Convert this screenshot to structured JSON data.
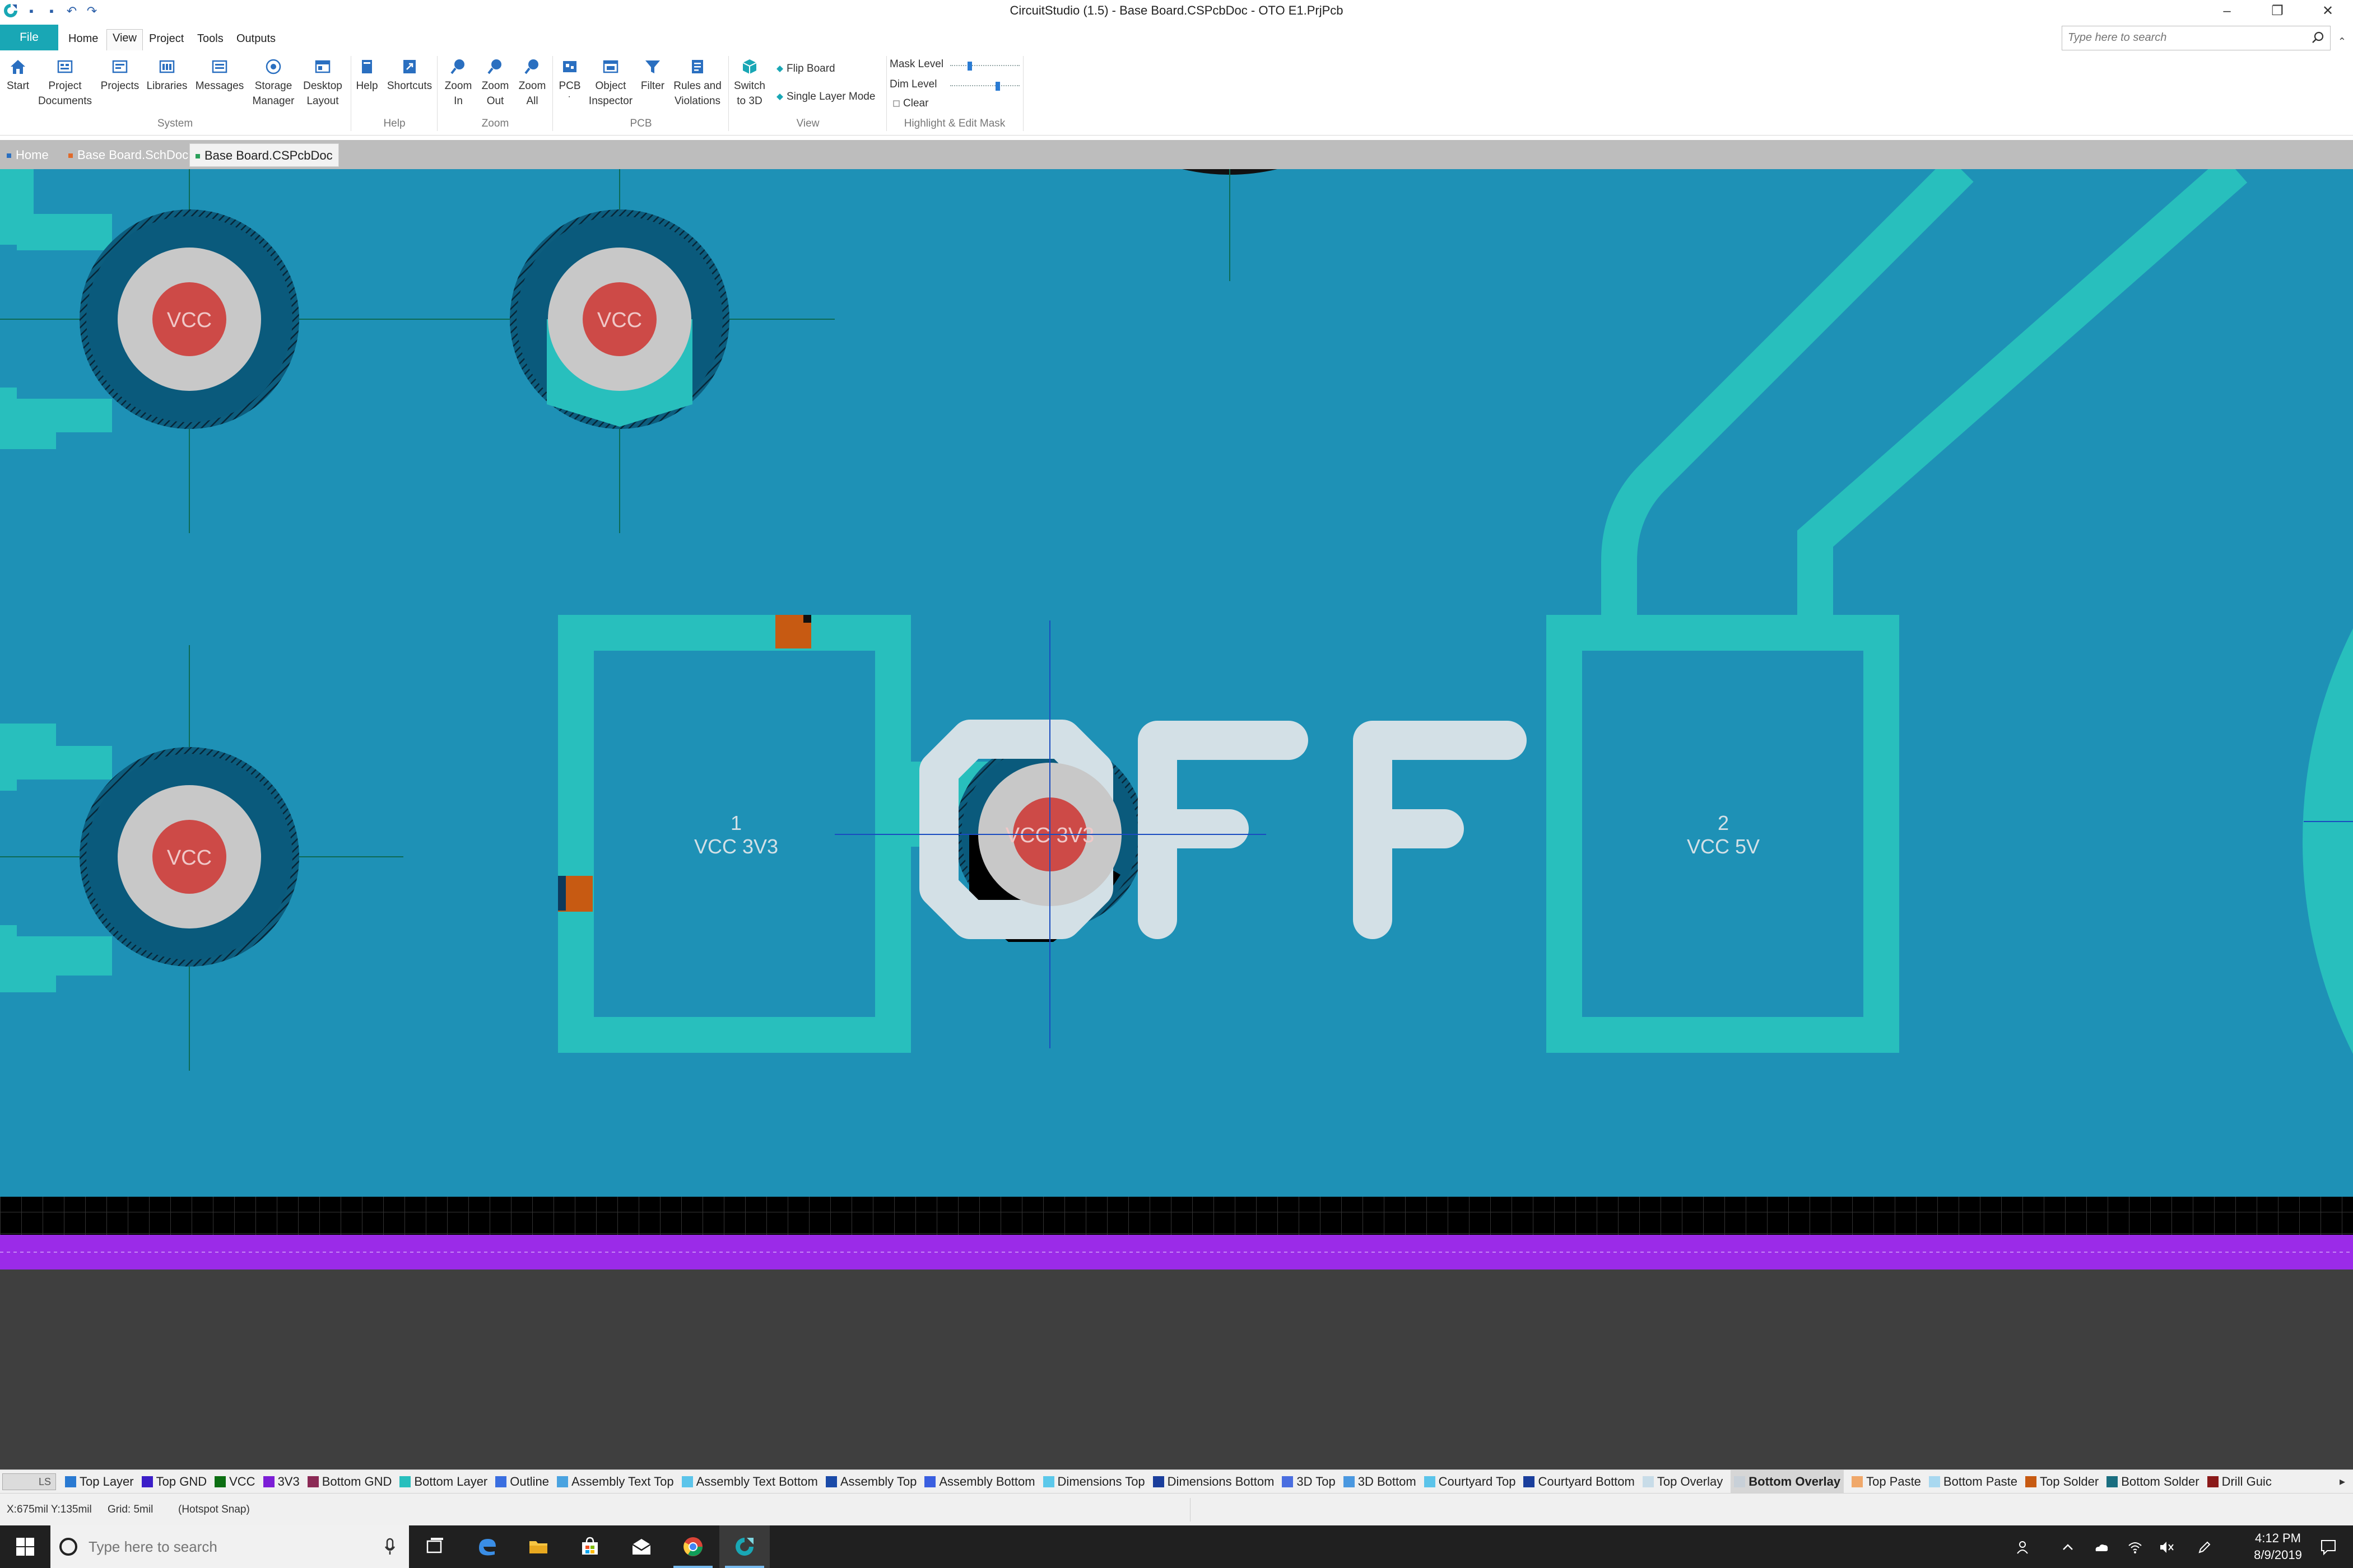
{
  "window": {
    "title": "CircuitStudio (1.5) - Base Board.CSPcbDoc - OTO E1.PrjPcb",
    "controls": [
      "minimize-icon",
      "restore-icon",
      "close-icon"
    ]
  },
  "menu": {
    "file": "File",
    "items": [
      "Home",
      "View",
      "Project",
      "Tools",
      "Outputs"
    ],
    "active": "View"
  },
  "search": {
    "placeholder": "Type here to search"
  },
  "ribbon": {
    "buttons": {
      "start": "Start",
      "project_documents_1": "Project",
      "project_documents_2": "Documents",
      "projects": "Projects",
      "libraries": "Libraries",
      "messages": "Messages",
      "storage_1": "Storage",
      "storage_2": "Manager",
      "desktop_1": "Desktop",
      "desktop_2": "Layout",
      "help": "Help",
      "shortcuts": "Shortcuts",
      "zoom_in_1": "Zoom",
      "zoom_in_2": "In",
      "zoom_out_1": "Zoom",
      "zoom_out_2": "Out",
      "zoom_all_1": "Zoom",
      "zoom_all_2": "All",
      "pcb": "PCB",
      "object_inspector_1": "Object",
      "object_inspector_2": "Inspector",
      "filter": "Filter",
      "rules_1": "Rules and",
      "rules_2": "Violations",
      "switch_3d_1": "Switch",
      "switch_3d_2": "to 3D",
      "flip_board": "Flip Board",
      "single_layer_mode": "Single Layer Mode",
      "mask_level": "Mask Level",
      "dim_level": "Dim Level",
      "clear": "Clear"
    },
    "groups": {
      "system": "System",
      "help": "Help",
      "zoom": "Zoom",
      "pcb": "PCB",
      "view": "View",
      "highlight": "Highlight & Edit Mask"
    },
    "mask_level": 0.27,
    "dim_level": 0.7
  },
  "doc_tabs": [
    {
      "label": "Home",
      "active": false
    },
    {
      "label": "Base Board.SchDoc",
      "active": false
    },
    {
      "label": "Base Board.CSPcbDoc",
      "active": true
    }
  ],
  "pcb": {
    "pads": {
      "vcc_top_left": "VCC",
      "vcc_top_mid": "VCC",
      "vcc_bottom_left": "VCC",
      "vcc_3v3": "VCC 3V3"
    },
    "smd_pad_1_num": "1",
    "smd_pad_1_net": "VCC 3V3",
    "smd_pad_2_num": "2",
    "smd_pad_2_net": "VCC 5V",
    "overlay_text": "OFF",
    "colors": {
      "board": "#1e91b6",
      "copper": "#28bfbd",
      "pad_ring": "#c8c8c8",
      "pad_hole": "#cd4a47",
      "overlay": "#d3e0e6",
      "dark_ring": "#0a5a7c",
      "orange": "#c75a12",
      "purple": "#9b2be8",
      "gray": "#3f3f3f"
    }
  },
  "layers": [
    {
      "name": "Top Layer",
      "color": "#2a7ad2"
    },
    {
      "name": "Top GND",
      "color": "#3b1ec8"
    },
    {
      "name": "VCC",
      "color": "#0c6e12"
    },
    {
      "name": "3V3",
      "color": "#7c1ed6"
    },
    {
      "name": "Bottom GND",
      "color": "#8b2a55"
    },
    {
      "name": "Bottom Layer",
      "color": "#28bfbd"
    },
    {
      "name": "Outline",
      "color": "#3a6ee0"
    },
    {
      "name": "Assembly Text Top",
      "color": "#4aa3e0"
    },
    {
      "name": "Assembly Text Bottom",
      "color": "#5bc4ea"
    },
    {
      "name": "Assembly Top",
      "color": "#1a4aa8"
    },
    {
      "name": "Assembly Bottom",
      "color": "#3a5fe0"
    },
    {
      "name": "Dimensions Top",
      "color": "#5bc8ea"
    },
    {
      "name": "Dimensions Bottom",
      "color": "#1a3e9c"
    },
    {
      "name": "3D Top",
      "color": "#4a6ee0"
    },
    {
      "name": "3D Bottom",
      "color": "#4a98e0"
    },
    {
      "name": "Courtyard Top",
      "color": "#5bc4ea"
    },
    {
      "name": "Courtyard Bottom",
      "color": "#1a3e9c"
    },
    {
      "name": "Top Overlay",
      "color": "#c8dce8"
    },
    {
      "name": "Bottom Overlay",
      "color": "#c8d0d8",
      "active": true
    },
    {
      "name": "Top Paste",
      "color": "#f0a86a"
    },
    {
      "name": "Bottom Paste",
      "color": "#a8d8f0"
    },
    {
      "name": "Top Solder",
      "color": "#c75a12"
    },
    {
      "name": "Bottom Solder",
      "color": "#1a6e80"
    },
    {
      "name": "Drill Guic",
      "color": "#8b1a1a"
    }
  ],
  "layer_toggle": "LS",
  "status": {
    "coords": "X:675mil Y:135mil",
    "grid": "Grid: 5mil",
    "snap": "(Hotspot Snap)"
  },
  "taskbar": {
    "search_placeholder": "Type here to search",
    "time": "4:12 PM",
    "date": "8/9/2019"
  }
}
